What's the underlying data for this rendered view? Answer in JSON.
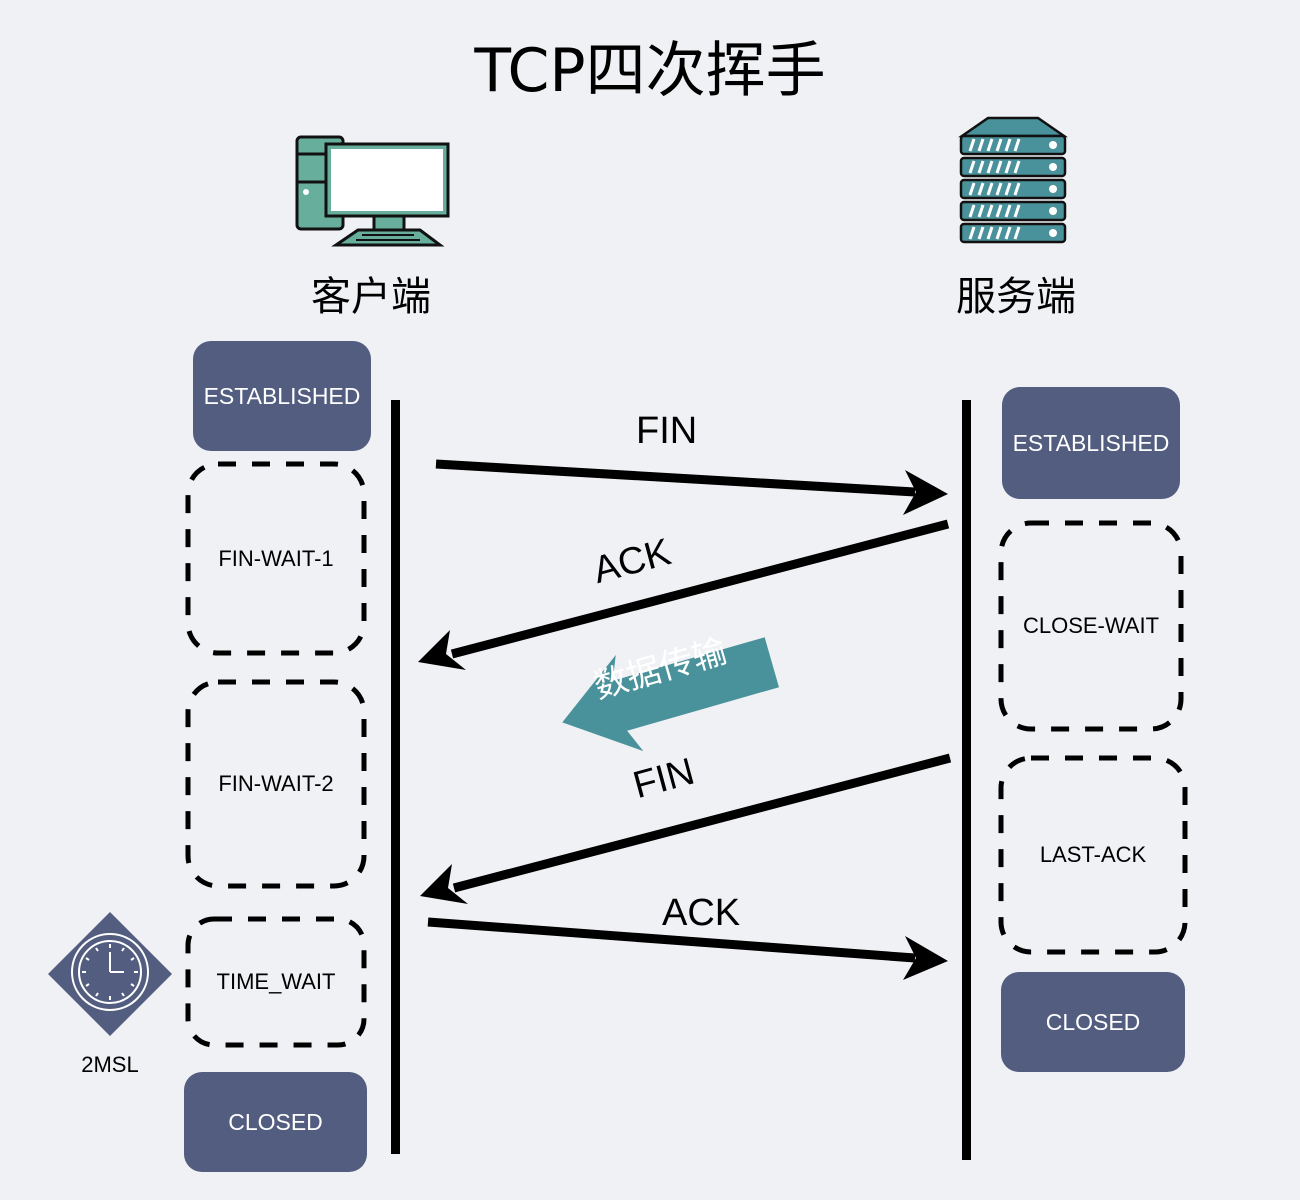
{
  "title": "TCP四次挥手",
  "client": {
    "label": "客户端",
    "icon": "desktop-computer-icon",
    "states": [
      "ESTABLISHED",
      "FIN-WAIT-1",
      "FIN-WAIT-2",
      "TIME_WAIT",
      "CLOSED"
    ]
  },
  "server": {
    "label": "服务端",
    "icon": "server-rack-icon",
    "states": [
      "ESTABLISHED",
      "CLOSE-WAIT",
      "LAST-ACK",
      "CLOSED"
    ]
  },
  "messages": [
    {
      "label": "FIN",
      "from": "client",
      "to": "server"
    },
    {
      "label": "ACK",
      "from": "server",
      "to": "client"
    },
    {
      "label": "FIN",
      "from": "server",
      "to": "client"
    },
    {
      "label": "ACK",
      "from": "client",
      "to": "server"
    }
  ],
  "data_transfer": {
    "label": "数据传输",
    "direction": "server-to-client"
  },
  "timer": {
    "label": "2MSL",
    "icon": "clock-icon"
  },
  "colors": {
    "background": "#f0f1f4",
    "state_fill": "#525d80",
    "icon_teal": "#4a929b",
    "icon_green": "#67ae9c",
    "arrow": "#000000"
  }
}
